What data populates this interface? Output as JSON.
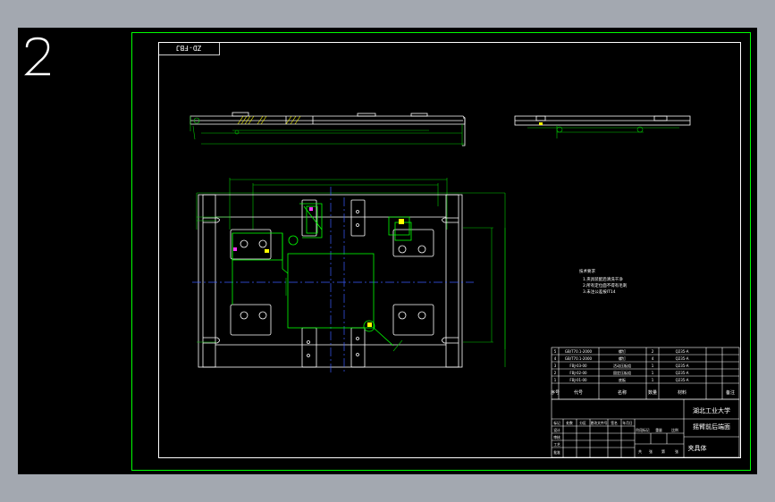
{
  "viewport": {
    "view_number": "2",
    "background": "#000000",
    "outer_frame_color": "#00ff00",
    "inner_frame_color": "#ffffff",
    "line_green": "#00ff00",
    "line_white": "#ffffff",
    "center_line_blue": "#3a5bff",
    "dim_green": "#00c800",
    "highlight_yellow": "#ffff00",
    "marker_magenta": "#ff33ff"
  },
  "drawing_number": "ZD-FBJ",
  "tech_notes": {
    "heading": "技术要求",
    "lines": [
      "1.夹具装配后清洗干净",
      "2.所有定位面不得有毛刺",
      "3.未注公差按IT14"
    ]
  },
  "parts_list": [
    {
      "no": "5",
      "code": "GB/T70.1-2000",
      "name": "螺钉",
      "qty": "2",
      "material": "Q235-A",
      "note": ""
    },
    {
      "no": "4",
      "code": "GB/T70.1-2000",
      "name": "螺钉",
      "qty": "4",
      "material": "Q235-A",
      "note": ""
    },
    {
      "no": "3",
      "code": "FBJ-03-00",
      "name": "活动压板组",
      "qty": "1",
      "material": "Q235-A",
      "note": ""
    },
    {
      "no": "2",
      "code": "FBJ-02-00",
      "name": "固定压板组",
      "qty": "1",
      "material": "Q235-A",
      "note": ""
    },
    {
      "no": "1",
      "code": "FBJ-01-00",
      "name": "底板",
      "qty": "1",
      "material": "Q235-A",
      "note": ""
    }
  ],
  "parts_header": {
    "no": "序号",
    "code": "代号",
    "name": "名称",
    "qty": "数量",
    "material": "材料",
    "note": "备注"
  },
  "title_block": {
    "university": "湖北工业大学",
    "title_line1": "摇臂前后端面",
    "title_line2": "夹具体",
    "labels": [
      "标记",
      "处数",
      "分区",
      "更改文件号",
      "签名",
      "年月日"
    ],
    "role_labels": [
      "设计",
      "审核",
      "工艺",
      "批准"
    ],
    "stage_labels": [
      "阶段标记",
      "重量",
      "比例"
    ],
    "bottom_labels": [
      "共",
      "张",
      "第",
      "张"
    ]
  }
}
